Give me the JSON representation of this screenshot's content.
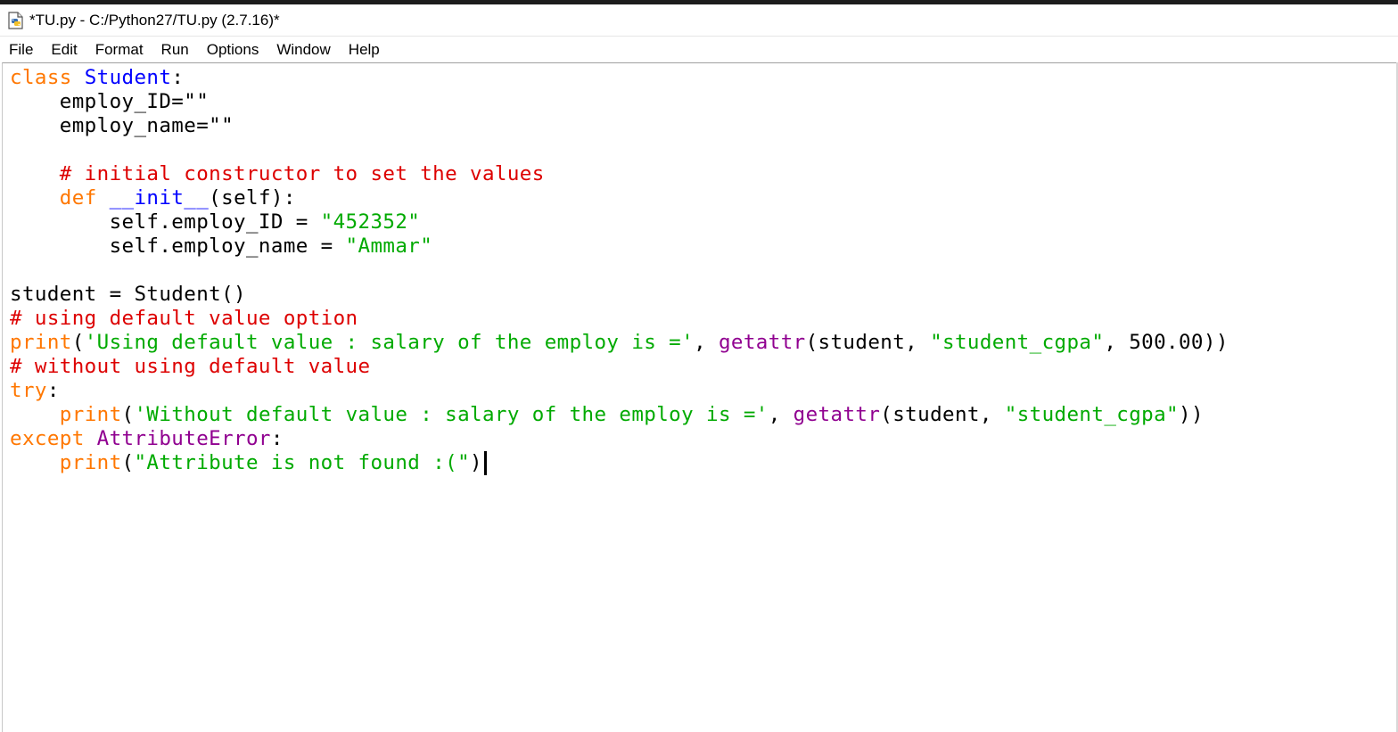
{
  "window": {
    "title": "*TU.py - C:/Python27/TU.py (2.7.16)*"
  },
  "menu": [
    "File",
    "Edit",
    "Format",
    "Run",
    "Options",
    "Window",
    "Help"
  ],
  "code": {
    "lines": [
      [
        {
          "t": "class ",
          "c": "kw"
        },
        {
          "t": "Student",
          "c": "def"
        },
        {
          "t": ":",
          "c": ""
        }
      ],
      [
        {
          "t": "    employ_ID=\"\"",
          "c": ""
        }
      ],
      [
        {
          "t": "    employ_name=\"\"",
          "c": ""
        }
      ],
      [],
      [
        {
          "t": "    # initial constructor to set the values",
          "c": "cm"
        }
      ],
      [
        {
          "t": "    ",
          "c": ""
        },
        {
          "t": "def ",
          "c": "kw"
        },
        {
          "t": "__init__",
          "c": "def"
        },
        {
          "t": "(self):",
          "c": ""
        }
      ],
      [
        {
          "t": "        self.employ_ID = ",
          "c": ""
        },
        {
          "t": "\"452352\"",
          "c": "str"
        }
      ],
      [
        {
          "t": "        self.employ_name = ",
          "c": ""
        },
        {
          "t": "\"Ammar\"",
          "c": "str"
        }
      ],
      [],
      [
        {
          "t": "student = Student()",
          "c": ""
        }
      ],
      [
        {
          "t": "# using default value option",
          "c": "cm"
        }
      ],
      [
        {
          "t": "print",
          "c": "kw"
        },
        {
          "t": "(",
          "c": ""
        },
        {
          "t": "'Using default value : salary of the employ is ='",
          "c": "str"
        },
        {
          "t": ", ",
          "c": ""
        },
        {
          "t": "getattr",
          "c": "bi"
        },
        {
          "t": "(student, ",
          "c": ""
        },
        {
          "t": "\"student_cgpa\"",
          "c": "str"
        },
        {
          "t": ", 500.00))",
          "c": ""
        }
      ],
      [
        {
          "t": "# without using default value",
          "c": "cm"
        }
      ],
      [
        {
          "t": "try",
          "c": "kw"
        },
        {
          "t": ":",
          "c": ""
        }
      ],
      [
        {
          "t": "    ",
          "c": ""
        },
        {
          "t": "print",
          "c": "kw"
        },
        {
          "t": "(",
          "c": ""
        },
        {
          "t": "'Without default value : salary of the employ is ='",
          "c": "str"
        },
        {
          "t": ", ",
          "c": ""
        },
        {
          "t": "getattr",
          "c": "bi"
        },
        {
          "t": "(student, ",
          "c": ""
        },
        {
          "t": "\"student_cgpa\"",
          "c": "str"
        },
        {
          "t": "))",
          "c": ""
        }
      ],
      [
        {
          "t": "except ",
          "c": "kw"
        },
        {
          "t": "AttributeError",
          "c": "bi"
        },
        {
          "t": ":",
          "c": ""
        }
      ],
      [
        {
          "t": "    ",
          "c": ""
        },
        {
          "t": "print",
          "c": "kw"
        },
        {
          "t": "(",
          "c": ""
        },
        {
          "t": "\"Attribute is not found :(\"",
          "c": "str"
        },
        {
          "t": ")",
          "c": ""
        }
      ]
    ],
    "cursor_line": 16
  },
  "colors": {
    "keyword": "#ff7700",
    "definition": "#0000ff",
    "comment": "#dd0000",
    "string": "#00aa00",
    "builtin": "#900090"
  },
  "icons": {
    "app": "python-file-icon"
  }
}
